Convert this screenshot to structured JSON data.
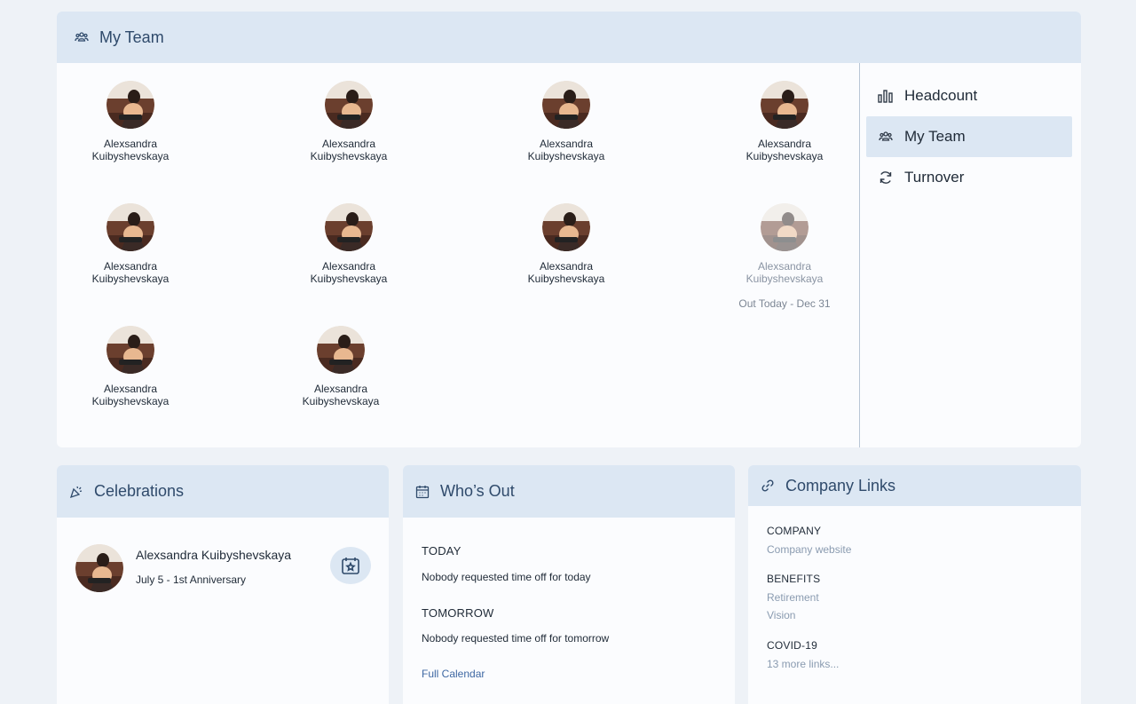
{
  "team": {
    "title": "My Team",
    "members": [
      {
        "name": "Alexsandra Kuibyshevskaya"
      },
      {
        "name": "Alexsandra Kuibyshevskaya"
      },
      {
        "name": "Alexsandra Kuibyshevskaya"
      },
      {
        "name": "Alexsandra Kuibyshevskaya"
      },
      {
        "name": "Alexsandra Kuibyshevskaya"
      },
      {
        "name": "Alexsandra Kuibyshevskaya"
      },
      {
        "name": "Alexsandra Kuibyshevskaya"
      },
      {
        "name": "Alexsandra Kuibyshevskaya",
        "out_note": "Out Today - Dec 31"
      },
      {
        "name": "Alexsandra Kuibyshevskaya"
      },
      {
        "name": "Alexsandra Kuibyshevskaya"
      }
    ]
  },
  "side_nav": {
    "items": [
      {
        "label": "Headcount",
        "icon": "bar-chart-icon"
      },
      {
        "label": "My Team",
        "icon": "team-icon",
        "active": true
      },
      {
        "label": "Turnover",
        "icon": "refresh-icon"
      }
    ]
  },
  "celebrations": {
    "title": "Celebrations",
    "name": "Alexsandra Kuibyshevskaya",
    "event": "July 5 - 1st Anniversary"
  },
  "whos_out": {
    "title": "Who’s Out",
    "today_label": "TODAY",
    "today_text": "Nobody requested time off for today",
    "tomorrow_label": "TOMORROW",
    "tomorrow_text": "Nobody requested time off for tomorrow",
    "calendar_link": "Full Calendar"
  },
  "company_links": {
    "title": "Company Links",
    "company_label": "COMPANY",
    "company_website": "Company website",
    "benefits_label": "BENEFITS",
    "retirement": "Retirement",
    "vision": "Vision",
    "covid_label": "COVID-19",
    "more_links": "13 more links..."
  },
  "colors": {
    "page_bg": "#eef2f7",
    "header_bg": "#dce7f3",
    "header_text": "#2f4a6b",
    "link": "#3f68a3",
    "muted_link": "#8a9bb0"
  }
}
